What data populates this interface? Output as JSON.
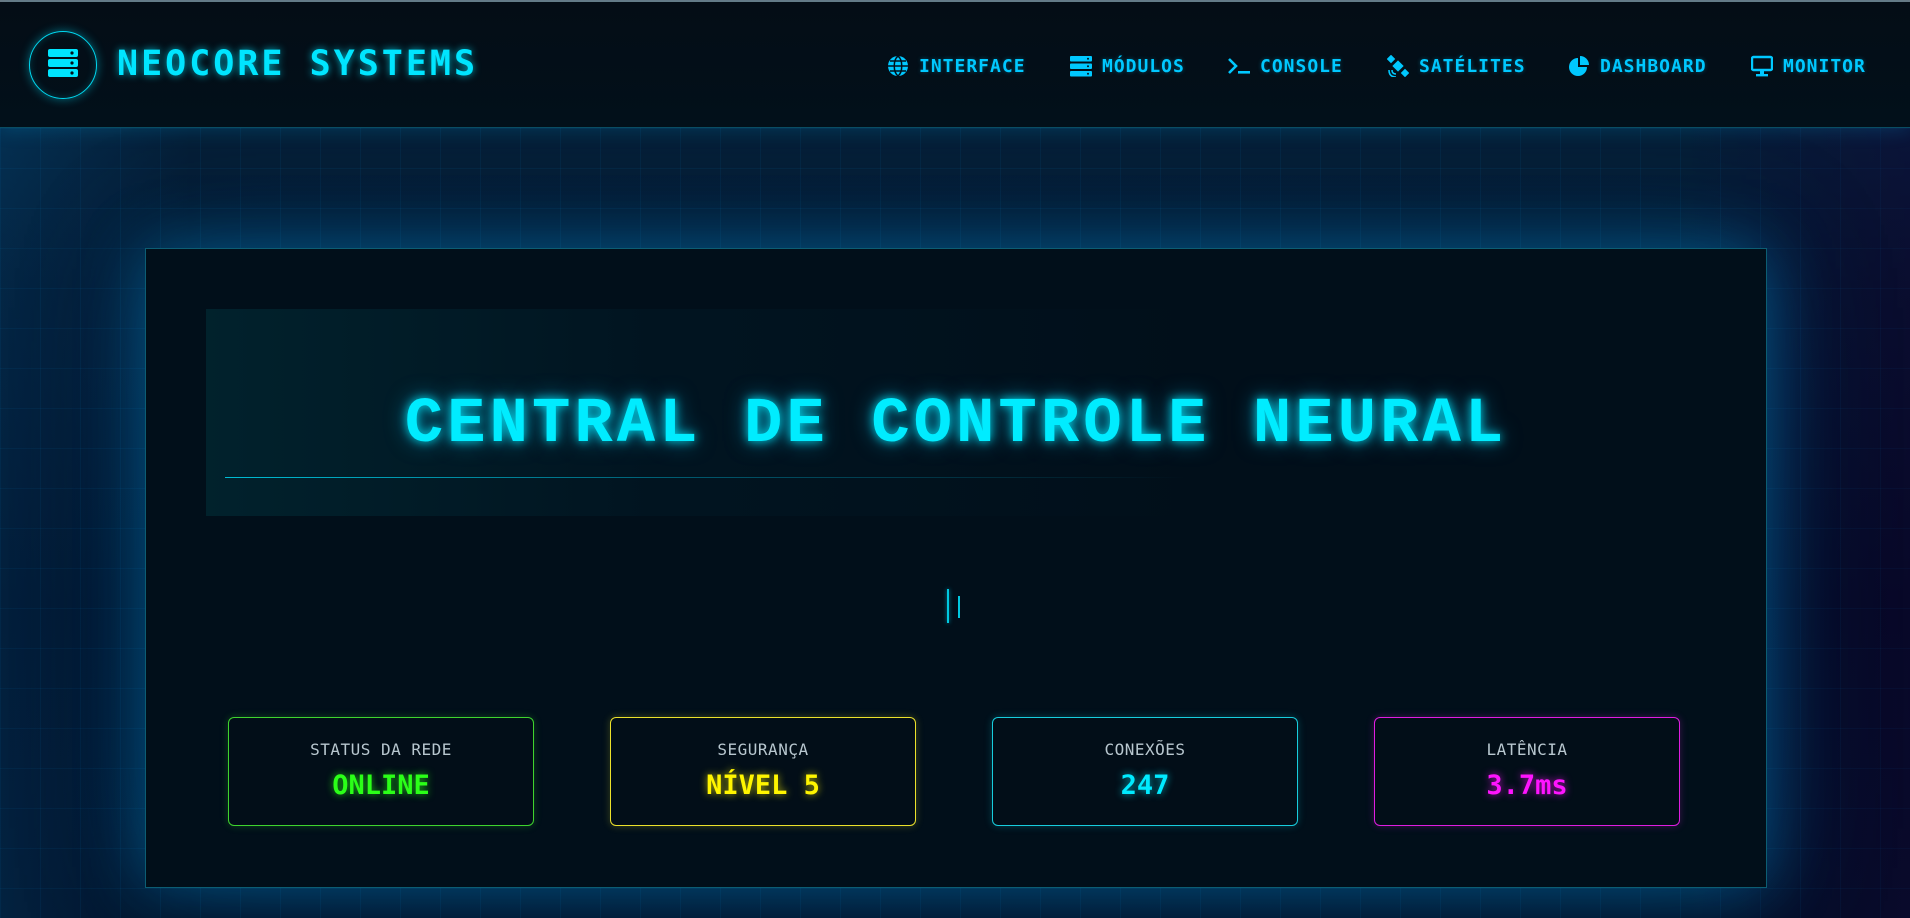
{
  "header": {
    "brand": "NEOCORE SYSTEMS",
    "logo_icon": "server-icon",
    "nav": [
      {
        "label": "INTERFACE",
        "icon": "globe-icon"
      },
      {
        "label": "MÓDULOS",
        "icon": "server-icon"
      },
      {
        "label": "CONSOLE",
        "icon": "terminal-icon"
      },
      {
        "label": "SATÉLITES",
        "icon": "satellite-icon"
      },
      {
        "label": "DASHBOARD",
        "icon": "pie-chart-icon"
      },
      {
        "label": "MONITOR",
        "icon": "monitor-icon"
      }
    ]
  },
  "main": {
    "title": "CENTRAL DE CONTROLE NEURAL",
    "stats": [
      {
        "label": "STATUS DA REDE",
        "value": "ONLINE",
        "color": "#2bff18"
      },
      {
        "label": "SEGURANÇA",
        "value": "NÍVEL 5",
        "color": "#fff500"
      },
      {
        "label": "CONEXÕES",
        "value": "247",
        "color": "#00eaff"
      },
      {
        "label": "LATÊNCIA",
        "value": "3.7ms",
        "color": "#ff14ff"
      }
    ]
  },
  "colors": {
    "accent": "#00e5ff",
    "nav": "#00c8ff",
    "background": "#010816"
  }
}
